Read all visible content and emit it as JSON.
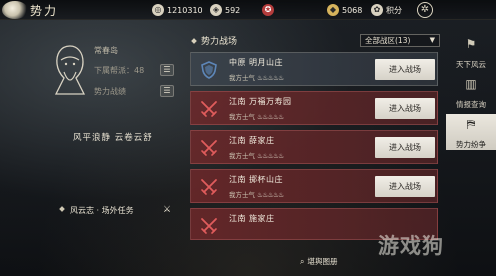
{
  "header": {
    "title": "势力",
    "menu_icon": "menu-icon",
    "resources": [
      {
        "name": "silver",
        "icon": "coin-stack-icon",
        "value": "1210310"
      },
      {
        "name": "coupon",
        "icon": "token-icon",
        "value": "592"
      },
      {
        "name": "ingot",
        "icon": "ingot-icon",
        "value": ""
      },
      {
        "name": "gold",
        "icon": "gold-icon",
        "value": "5068"
      },
      {
        "name": "points",
        "icon": "points-icon",
        "value": "积分"
      }
    ]
  },
  "profile": {
    "name": "常春岛",
    "rows": [
      {
        "label": "下属帮派：48"
      },
      {
        "label": "势力战绩"
      }
    ],
    "motto": "风平浪静  云卷云舒",
    "quest_label": "风云志 · 场外任务"
  },
  "battlefield": {
    "title": "势力战场",
    "filter": "全部战区(13)",
    "enter_label": "进入战场",
    "morale_label": "我方士气",
    "items": [
      {
        "region": "中原",
        "place": "明月山庄",
        "status": "friendly",
        "morale_icons": "♨♨♨♨♨"
      },
      {
        "region": "江南",
        "place": "万福万寿园",
        "status": "hostile",
        "morale_icons": "♨♨♨♨♨"
      },
      {
        "region": "江南",
        "place": "薛家庄",
        "status": "hostile",
        "morale_icons": "♨♨♨♨♨"
      },
      {
        "region": "江南",
        "place": "掷杯山庄",
        "status": "hostile",
        "morale_icons": "♨♨♨♨♨"
      },
      {
        "region": "江南",
        "place": "施家庄",
        "status": "hostile",
        "morale_icons": ""
      }
    ],
    "footer": "堪舆图册"
  },
  "tabs": [
    {
      "label": "天下风云",
      "icon": "flag-icon",
      "active": false
    },
    {
      "label": "情报查询",
      "icon": "scroll-icon",
      "active": false
    },
    {
      "label": "势力纷争",
      "icon": "banner-icon",
      "active": true
    }
  ],
  "watermark": "游戏狗",
  "colors": {
    "hostile": "#6e282a",
    "friendly": "#3c444e",
    "button": "#ebe7de",
    "shield": "#5d86b8",
    "swords": "#e05c5c"
  }
}
